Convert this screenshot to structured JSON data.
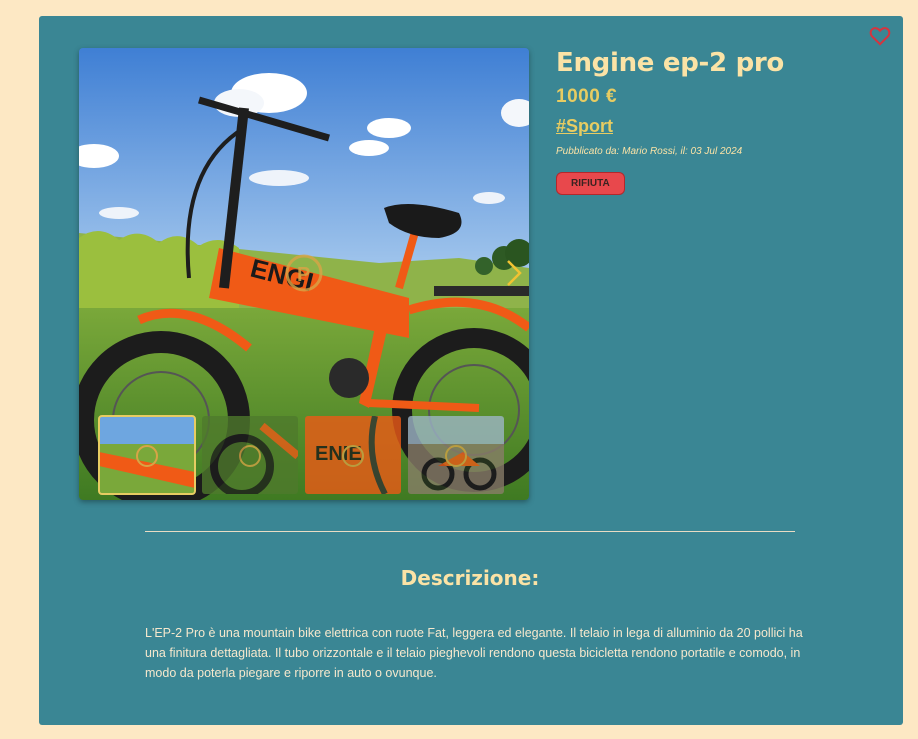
{
  "product": {
    "title": "Engine ep-2 pro",
    "price": "1000 €",
    "category_tag": "#Sport",
    "published": "Pubblicato da: Mario Rossi, il: 03 Jul 2024",
    "reject_label": "RIFIUTA"
  },
  "description": {
    "heading": "Descrizione:",
    "text": "L'EP-2 Pro è una mountain bike elettrica con ruote Fat, leggera ed elegante. Il telaio in lega di alluminio da 20 pollici ha una finitura dettagliata. Il tubo orizzontale e il telaio pieghevoli rendono questa bicicletta rendono portatile e comodo, in modo da poterla piegare e riporre in auto o ovunque."
  },
  "gallery": {
    "main_image": "orange-folding-ebike-in-field",
    "thumbnails": [
      {
        "image": "bike-frame-closeup",
        "active": true
      },
      {
        "image": "bike-wheel-closeup",
        "active": false
      },
      {
        "image": "bike-logo-closeup",
        "active": false
      },
      {
        "image": "bike-on-beach",
        "active": false
      }
    ]
  },
  "icons": {
    "favorite": "heart-icon",
    "next": "chevron-right-icon"
  },
  "colors": {
    "page_background": "#fde8c4",
    "card_background": "#3a8694",
    "title": "#fbe3a6",
    "accent": "#e7cc62",
    "reject_button": "#e8484c"
  }
}
